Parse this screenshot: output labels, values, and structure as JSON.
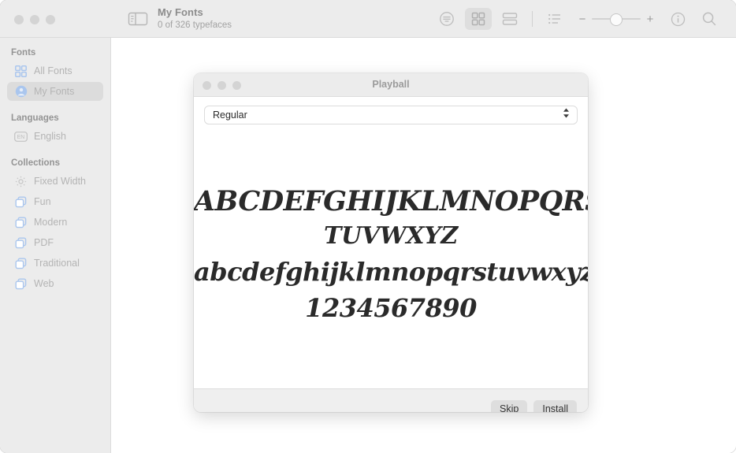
{
  "window": {
    "traffic_lights": [
      "close",
      "minimize",
      "zoom"
    ]
  },
  "toolbar": {
    "sidebar_toggle_icon": "sidebar-toggle-icon",
    "title": "My Fonts",
    "subtitle": "0 of 326 typefaces",
    "buttons": [
      {
        "name": "preview-options",
        "icon": "lines-in-circle-icon",
        "selected": false
      },
      {
        "name": "grid-view",
        "icon": "grid-view-icon",
        "selected": true
      },
      {
        "name": "split-view",
        "icon": "split-view-icon",
        "selected": false
      },
      {
        "name": "list-view",
        "icon": "list-view-icon",
        "selected": false
      }
    ],
    "zoom": {
      "minus_label": "−",
      "plus_label": "+",
      "value_percent": 38
    },
    "info_icon": "info-circle-icon",
    "search_icon": "search-icon"
  },
  "sidebar": {
    "sections": [
      {
        "header": "Fonts",
        "items": [
          {
            "label": "All Fonts",
            "icon": "grid-icon",
            "selected": false
          },
          {
            "label": "My Fonts",
            "icon": "person-circle-icon",
            "selected": true
          }
        ]
      },
      {
        "header": "Languages",
        "items": [
          {
            "label": "English",
            "icon": "en-badge-icon",
            "selected": false
          }
        ]
      },
      {
        "header": "Collections",
        "items": [
          {
            "label": "Fixed Width",
            "icon": "gear-icon",
            "selected": false
          },
          {
            "label": "Fun",
            "icon": "stacked-squares-icon",
            "selected": false
          },
          {
            "label": "Modern",
            "icon": "stacked-squares-icon",
            "selected": false
          },
          {
            "label": "PDF",
            "icon": "stacked-squares-icon",
            "selected": false
          },
          {
            "label": "Traditional",
            "icon": "stacked-squares-icon",
            "selected": false
          },
          {
            "label": "Web",
            "icon": "stacked-squares-icon",
            "selected": false
          }
        ]
      }
    ]
  },
  "dialog": {
    "title": "Playball",
    "style_select": {
      "value": "Regular"
    },
    "specimen": {
      "line1": "ABCDEFGHIJKLMNOPQRS",
      "line2": "TUVWXYZ",
      "line3": "abcdefghijklmnopqrstuvwxyz",
      "line4": "1234567890"
    },
    "buttons": {
      "skip": "Skip",
      "install": "Install"
    }
  },
  "colors": {
    "toolbar_bg": "#ececec",
    "sidebar_bg": "#ececec",
    "content_bg": "#ffffff",
    "accent_icon": "#aac6ee",
    "selected_row_bg": "#dcdcdc",
    "text_muted": "#b4b4b4",
    "specimen_text": "#2a2a2a"
  }
}
